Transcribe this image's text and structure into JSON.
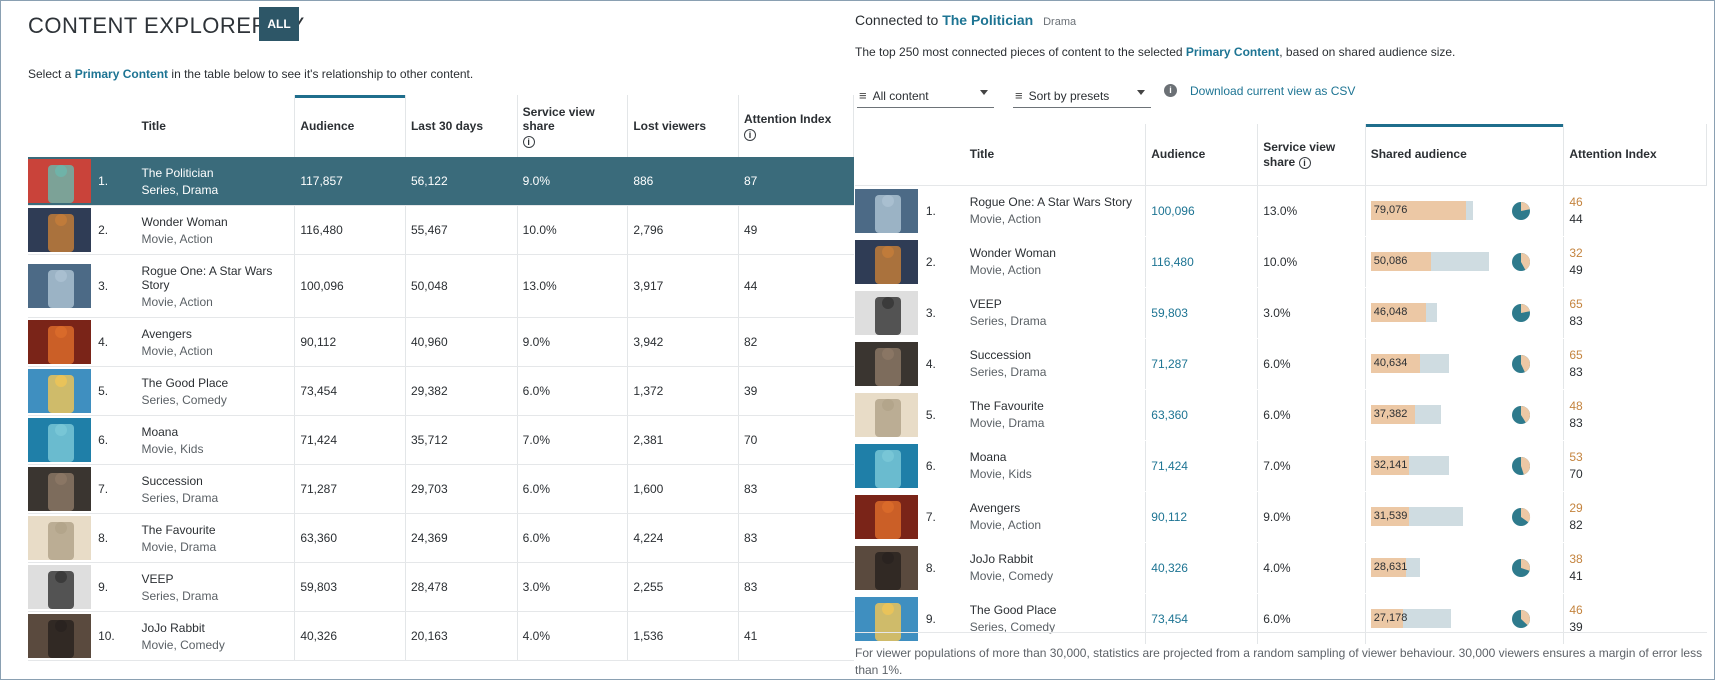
{
  "left": {
    "title": "CONTENT EXPLORER BY",
    "all_label": "ALL",
    "instruction_pre": "Select a",
    "instruction_hl": "Primary Content",
    "instruction_post": "in the table below to see it's relationship to other content.",
    "columns": [
      "Title",
      "Audience",
      "Last 30 days",
      "Service view share",
      "Lost viewers",
      "Attention Index"
    ],
    "rows": [
      {
        "rank": "1.",
        "title": "The Politician",
        "sub": "Series, Drama",
        "audience": "117,857",
        "last30": "56,122",
        "share": "9.0%",
        "lost": "886",
        "attention": "87",
        "thumb": [
          "#c9433a",
          "#6fb3a8"
        ],
        "selected": true
      },
      {
        "rank": "2.",
        "title": "Wonder Woman",
        "sub": "Movie, Action",
        "audience": "116,480",
        "last30": "55,467",
        "share": "10.0%",
        "lost": "2,796",
        "attention": "49",
        "thumb": [
          "#2f3c55",
          "#c07b3a"
        ]
      },
      {
        "rank": "3.",
        "title": "Rogue One: A Star Wars Story",
        "sub": "Movie, Action",
        "audience": "100,096",
        "last30": "50,048",
        "share": "13.0%",
        "lost": "3,917",
        "attention": "44",
        "thumb": [
          "#4c6a86",
          "#a9bfd0"
        ]
      },
      {
        "rank": "4.",
        "title": "Avengers",
        "sub": "Movie, Action",
        "audience": "90,112",
        "last30": "40,960",
        "share": "9.0%",
        "lost": "3,942",
        "attention": "82",
        "thumb": [
          "#7a2418",
          "#d96a2a"
        ]
      },
      {
        "rank": "5.",
        "title": "The Good Place",
        "sub": "Series, Comedy",
        "audience": "73,454",
        "last30": "29,382",
        "share": "6.0%",
        "lost": "1,372",
        "attention": "39",
        "thumb": [
          "#3f8fc0",
          "#e9c35a"
        ]
      },
      {
        "rank": "6.",
        "title": "Moana",
        "sub": "Movie, Kids",
        "audience": "71,424",
        "last30": "35,712",
        "share": "7.0%",
        "lost": "2,381",
        "attention": "70",
        "thumb": [
          "#1f7fa8",
          "#78c6d6"
        ]
      },
      {
        "rank": "7.",
        "title": "Succession",
        "sub": "Series, Drama",
        "audience": "71,287",
        "last30": "29,703",
        "share": "6.0%",
        "lost": "1,600",
        "attention": "83",
        "thumb": [
          "#3a3530",
          "#8a7664"
        ]
      },
      {
        "rank": "8.",
        "title": "The Favourite",
        "sub": "Movie, Drama",
        "audience": "63,360",
        "last30": "24,369",
        "share": "6.0%",
        "lost": "4,224",
        "attention": "83",
        "thumb": [
          "#e8dcc7",
          "#b3a58b"
        ]
      },
      {
        "rank": "9.",
        "title": "VEEP",
        "sub": "Series, Drama",
        "audience": "59,803",
        "last30": "28,478",
        "share": "3.0%",
        "lost": "2,255",
        "attention": "83",
        "thumb": [
          "#dedede",
          "#3b3b3b"
        ]
      },
      {
        "rank": "10.",
        "title": "JoJo Rabbit",
        "sub": "Movie, Comedy",
        "audience": "40,326",
        "last30": "20,163",
        "share": "4.0%",
        "lost": "1,536",
        "attention": "41",
        "thumb": [
          "#5a4a3e",
          "#2a2320"
        ]
      }
    ]
  },
  "right": {
    "connected_label": "Connected to",
    "connected_title": "The Politician",
    "connected_genre": "Drama",
    "desc_pre": "The top 250 most connected pieces of content to the selected",
    "desc_hl": "Primary Content",
    "desc_post": ", based on shared audience size.",
    "filter_label": "All content",
    "sort_label": "Sort by presets",
    "info_glyph": "i",
    "csv_label": "Download current view as CSV",
    "columns": [
      "Title",
      "Audience",
      "Service view share",
      "Shared audience",
      "Attention Index"
    ],
    "rows": [
      {
        "rank": "1.",
        "title": "Rogue One: A Star Wars Story",
        "sub": "Movie, Action",
        "audience": "100,096",
        "share": "13.0%",
        "shared": "79,076",
        "shared_frac": 0.79,
        "total_frac": 0.85,
        "pie_frac": 0.22,
        "attn_a": "46",
        "attn_b": "44",
        "thumb": [
          "#4c6a86",
          "#a9bfd0"
        ]
      },
      {
        "rank": "2.",
        "title": "Wonder Woman",
        "sub": "Movie, Action",
        "audience": "116,480",
        "share": "10.0%",
        "shared": "50,086",
        "shared_frac": 0.5,
        "total_frac": 0.98,
        "pie_frac": 0.42,
        "attn_a": "32",
        "attn_b": "49",
        "thumb": [
          "#2f3c55",
          "#c07b3a"
        ]
      },
      {
        "rank": "3.",
        "title": "VEEP",
        "sub": "Series, Drama",
        "audience": "59,803",
        "share": "3.0%",
        "shared": "46,048",
        "shared_frac": 0.46,
        "total_frac": 0.55,
        "pie_frac": 0.22,
        "attn_a": "65",
        "attn_b": "83",
        "thumb": [
          "#dedede",
          "#3b3b3b"
        ]
      },
      {
        "rank": "4.",
        "title": "Succession",
        "sub": "Series, Drama",
        "audience": "71,287",
        "share": "6.0%",
        "shared": "40,634",
        "shared_frac": 0.41,
        "total_frac": 0.65,
        "pie_frac": 0.43,
        "attn_a": "65",
        "attn_b": "83",
        "thumb": [
          "#3a3530",
          "#8a7664"
        ]
      },
      {
        "rank": "5.",
        "title": "The Favourite",
        "sub": "Movie, Drama",
        "audience": "63,360",
        "share": "6.0%",
        "shared": "37,382",
        "shared_frac": 0.37,
        "total_frac": 0.58,
        "pie_frac": 0.41,
        "attn_a": "48",
        "attn_b": "83",
        "thumb": [
          "#e8dcc7",
          "#b3a58b"
        ]
      },
      {
        "rank": "6.",
        "title": "Moana",
        "sub": "Movie, Kids",
        "audience": "71,424",
        "share": "7.0%",
        "shared": "32,141",
        "shared_frac": 0.32,
        "total_frac": 0.65,
        "pie_frac": 0.45,
        "attn_a": "53",
        "attn_b": "70",
        "thumb": [
          "#1f7fa8",
          "#78c6d6"
        ]
      },
      {
        "rank": "7.",
        "title": "Avengers",
        "sub": "Movie, Action",
        "audience": "90,112",
        "share": "9.0%",
        "shared": "31,539",
        "shared_frac": 0.32,
        "total_frac": 0.77,
        "pie_frac": 0.35,
        "attn_a": "29",
        "attn_b": "82",
        "thumb": [
          "#7a2418",
          "#d96a2a"
        ]
      },
      {
        "rank": "8.",
        "title": "JoJo Rabbit",
        "sub": "Movie, Comedy",
        "audience": "40,326",
        "share": "4.0%",
        "shared": "28,631",
        "shared_frac": 0.29,
        "total_frac": 0.41,
        "pie_frac": 0.3,
        "attn_a": "38",
        "attn_b": "41",
        "thumb": [
          "#5a4a3e",
          "#2a2320"
        ]
      },
      {
        "rank": "9.",
        "title": "The Good Place",
        "sub": "Series, Comedy",
        "audience": "73,454",
        "share": "6.0%",
        "shared": "27,178",
        "shared_frac": 0.27,
        "total_frac": 0.67,
        "pie_frac": 0.37,
        "attn_a": "46",
        "attn_b": "39",
        "thumb": [
          "#3f8fc0",
          "#e9c35a"
        ]
      }
    ],
    "footnote": "For viewer populations of more than 30,000, statistics are projected from a random sampling of viewer behaviour. 30,000 viewers ensures a margin of error less than 1%."
  },
  "colors": {
    "accent": "#1d7493",
    "selected_row": "#3a6b7b",
    "button": "#2d5667",
    "bar_shared": "#ecc8a5",
    "bar_total": "#cfdce1",
    "pie_main": "#2e7a8c",
    "pie_slice": "#ecc8a5",
    "attention_orange": "#c4843f"
  }
}
